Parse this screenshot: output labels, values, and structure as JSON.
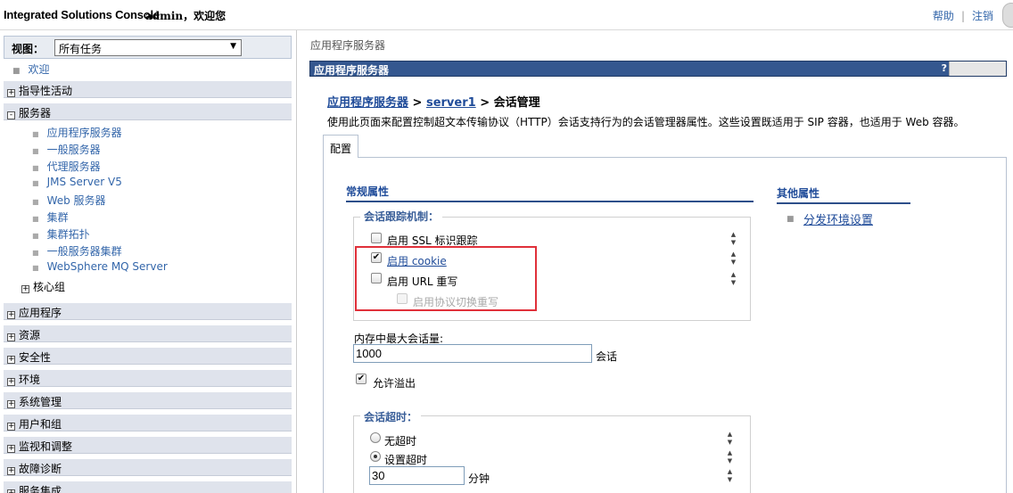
{
  "banner": {
    "brand": "Integrated Solutions Console",
    "user": "admin，欢迎您",
    "help": "帮助",
    "separator": "|",
    "logout": "注销"
  },
  "nav": {
    "view_label": "视图：",
    "view_value": "所有任务",
    "welcome": "欢迎",
    "categories": {
      "guided": "指导性活动",
      "servers": "服务器",
      "applications": "应用程序",
      "resources": "资源",
      "security": "安全性",
      "environment": "环境",
      "system_admin": "系统管理",
      "users_groups": "用户和组",
      "monitoring": "监视和调整",
      "troubleshooting": "故障诊断",
      "service_integration": "服务集成"
    },
    "server_items": [
      "应用程序服务器",
      "一般服务器",
      "代理服务器",
      "JMS Server V5",
      "Web 服务器",
      "集群",
      "集群拓扑",
      "一般服务器集群",
      "WebSphere MQ Server"
    ],
    "core_group": "核心组",
    "expand_symbol": "+",
    "collapse_symbol": "-"
  },
  "main": {
    "crumb_top": "应用程序服务器",
    "title": "应用程序服务器",
    "help_mark": "?",
    "path": {
      "link1": "应用程序服务器",
      "sep1": " > ",
      "link2": "server1",
      "sep2": " > ",
      "current": "会话管理"
    },
    "description": "使用此页面来配置控制超文本传输协议（HTTP）会话支持行为的会话管理器属性。这些设置既适用于 SIP 容器，也适用于 Web 容器。",
    "tab": "配置",
    "general_title": "常规属性",
    "tracking": {
      "legend": "会话跟踪机制：",
      "ssl": "启用 SSL 标识跟踪",
      "cookie": "启用 cookie",
      "url": "启用 URL 重写",
      "protocol": "启用协议切换重写"
    },
    "max_sessions": {
      "label": "内存中最大会话量:",
      "value": "1000",
      "unit": "会话"
    },
    "overflow": "允许溢出",
    "timeout": {
      "legend": "会话超时：",
      "none": "无超时",
      "set": "设置超时",
      "value": "30",
      "unit": "分钟"
    },
    "other_title": "其他属性",
    "other_link": "分发环境设置"
  }
}
